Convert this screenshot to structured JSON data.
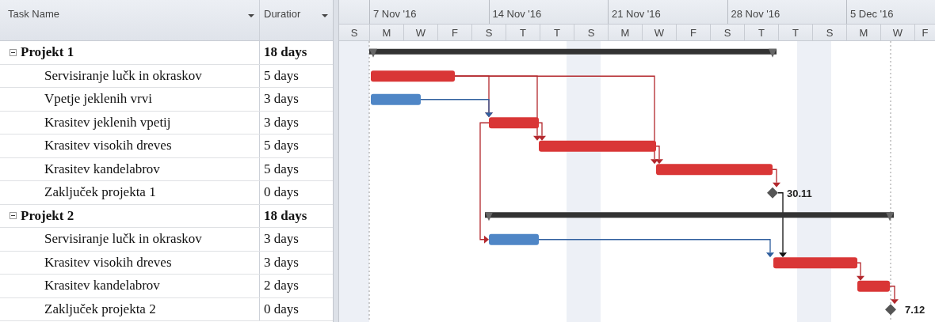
{
  "columns": [
    {
      "label": "Task Name"
    },
    {
      "label": "Duratior"
    }
  ],
  "timescale": {
    "weeks": [
      "7 Nov '16",
      "14 Nov '16",
      "21 Nov '16",
      "28 Nov '16",
      "5 Dec '16"
    ],
    "days": [
      "S",
      "M",
      "W",
      "F",
      "S",
      "T",
      "T",
      "S",
      "M",
      "W",
      "F",
      "S",
      "T",
      "T",
      "S",
      "M",
      "W",
      "F"
    ]
  },
  "tasks": [
    {
      "name": "Projekt 1",
      "duration": "18 days",
      "expanded": true,
      "children": [
        {
          "name": "Servisiranje lučk in okraskov",
          "duration": "5 days",
          "kind": "bar",
          "color": "#d93636"
        },
        {
          "name": "Vpetje jeklenih vrvi",
          "duration": "3 days",
          "kind": "bar",
          "color": "#4f86c6"
        },
        {
          "name": "Krasitev jeklenih vpetij",
          "duration": "3 days",
          "kind": "bar",
          "color": "#d93636"
        },
        {
          "name": "Krasitev visokih dreves",
          "duration": "5 days",
          "kind": "bar",
          "color": "#d93636"
        },
        {
          "name": "Krasitev kandelabrov",
          "duration": "5 days",
          "kind": "bar",
          "color": "#d93636"
        },
        {
          "name": "Zaključek projekta 1",
          "duration": "0 days",
          "kind": "milestone",
          "date_label": "30.11"
        }
      ]
    },
    {
      "name": "Projekt 2",
      "duration": "18 days",
      "expanded": true,
      "children": [
        {
          "name": "Servisiranje lučk in okraskov",
          "duration": "3 days",
          "kind": "bar",
          "color": "#4f86c6"
        },
        {
          "name": "Krasitev visokih dreves",
          "duration": "3 days",
          "kind": "bar",
          "color": "#d93636"
        },
        {
          "name": "Krasitev kandelabrov",
          "duration": "2 days",
          "kind": "bar",
          "color": "#d93636"
        },
        {
          "name": "Zaključek projekta 2",
          "duration": "0 days",
          "kind": "milestone",
          "date_label": "7.12"
        }
      ]
    }
  ]
}
